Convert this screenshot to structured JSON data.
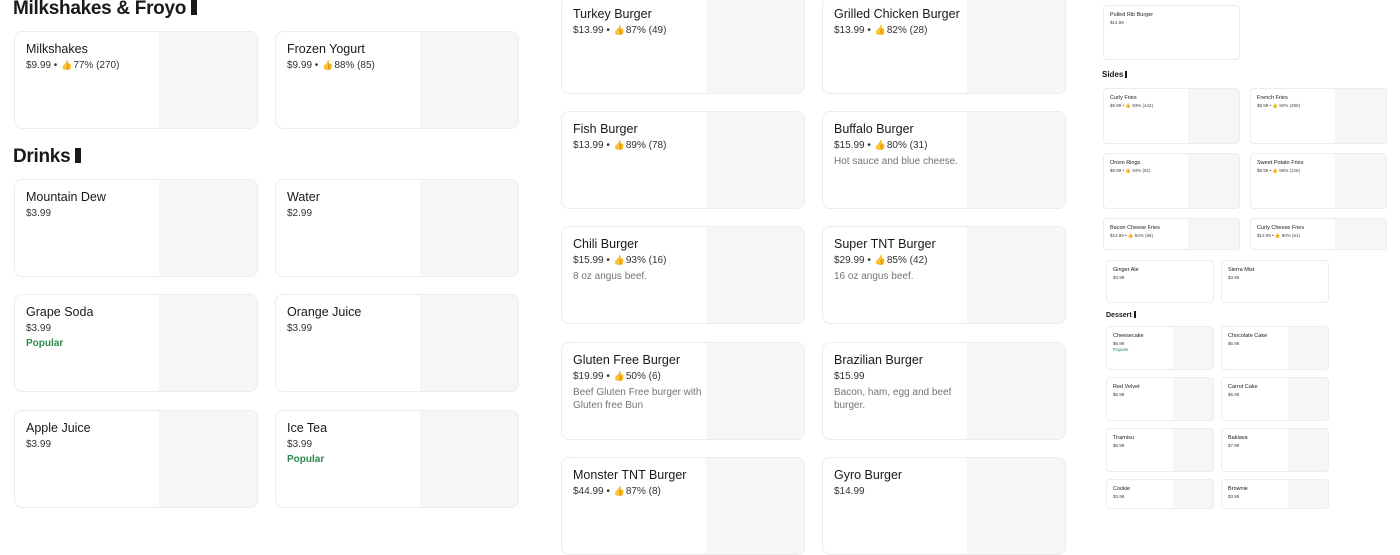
{
  "sections_left": [
    {
      "title": "Milkshakes & Froyo"
    },
    {
      "title": "Drinks"
    }
  ],
  "left_cards": [
    {
      "name": "Milkshakes",
      "price": "$9.99",
      "rating": "77% (270)"
    },
    {
      "name": "Frozen Yogurt",
      "price": "$9.99",
      "rating": "88% (85)"
    },
    {
      "name": "Mountain Dew",
      "price": "$3.99"
    },
    {
      "name": "Water",
      "price": "$2.99"
    },
    {
      "name": "Grape Soda",
      "price": "$3.99",
      "tag": "Popular"
    },
    {
      "name": "Orange Juice",
      "price": "$3.99"
    },
    {
      "name": "Apple Juice",
      "price": "$3.99"
    },
    {
      "name": "Ice Tea",
      "price": "$3.99",
      "tag": "Popular"
    }
  ],
  "mid_cards": [
    {
      "name": "Turkey Burger",
      "price": "$13.99",
      "rating": "87% (49)"
    },
    {
      "name": "Grilled Chicken Burger",
      "price": "$13.99",
      "rating": "82% (28)"
    },
    {
      "name": "Fish Burger",
      "price": "$13.99",
      "rating": "89% (78)"
    },
    {
      "name": "Buffalo Burger",
      "price": "$15.99",
      "rating": "80% (31)",
      "desc": "Hot sauce and blue cheese."
    },
    {
      "name": "Chili Burger",
      "price": "$15.99",
      "rating": "93% (16)",
      "desc": "8 oz angus beef."
    },
    {
      "name": "Super TNT Burger",
      "price": "$29.99",
      "rating": "85% (42)",
      "desc": "16 oz angus beef."
    },
    {
      "name": "Gluten Free Burger",
      "price": "$19.99",
      "rating": "50% (6)",
      "desc": "Beef Gluten Free burger with Gluten free Bun"
    },
    {
      "name": "Brazilian Burger",
      "price": "$15.99",
      "desc": "Bacon, ham, egg and beef burger."
    },
    {
      "name": "Monster TNT Burger",
      "price": "$44.99",
      "rating": "87% (8)"
    },
    {
      "name": "Gyro Burger",
      "price": "$14.99"
    }
  ],
  "right": {
    "top_card": {
      "name": "Pulled Rib Burger",
      "price": "$14.99"
    },
    "sides_title": "Sides",
    "sides": [
      {
        "name": "Curly Fries",
        "meta": "$9.99 • 👍 93% (442)"
      },
      {
        "name": "French Fries",
        "meta": "$9.99 • 👍 92% (290)"
      },
      {
        "name": "Onion Rings",
        "meta": "$9.99 • 👍 94% (91)"
      },
      {
        "name": "Sweet Potato Fries",
        "meta": "$9.99 • 👍 85% (126)"
      },
      {
        "name": "Bacon Cheese Fries",
        "meta": "$13.99 • 👍 84% (86)"
      },
      {
        "name": "Curly Cheese Fries",
        "meta": "$13.99 • 👍 80% (61)"
      }
    ],
    "drinks": [
      {
        "name": "Ginger Ale",
        "meta": "$3.99"
      },
      {
        "name": "Sierra Mist",
        "meta": "$3.99"
      }
    ],
    "dessert_title": "Dessert",
    "dessert": [
      {
        "name": "Cheesecake",
        "meta": "$6.99",
        "tag": "Popular"
      },
      {
        "name": "Chocolate Cake",
        "meta": "$6.99"
      },
      {
        "name": "Red Velvet",
        "meta": "$6.99"
      },
      {
        "name": "Carrot Cake",
        "meta": "$6.99"
      },
      {
        "name": "Tiramisu",
        "meta": "$6.99"
      },
      {
        "name": "Baklava",
        "meta": "$7.99"
      },
      {
        "name": "Cookie",
        "meta": "$3.99"
      },
      {
        "name": "Brownie",
        "meta": "$3.99"
      }
    ]
  },
  "icons": {
    "thumb": "thumbs-up-icon"
  }
}
